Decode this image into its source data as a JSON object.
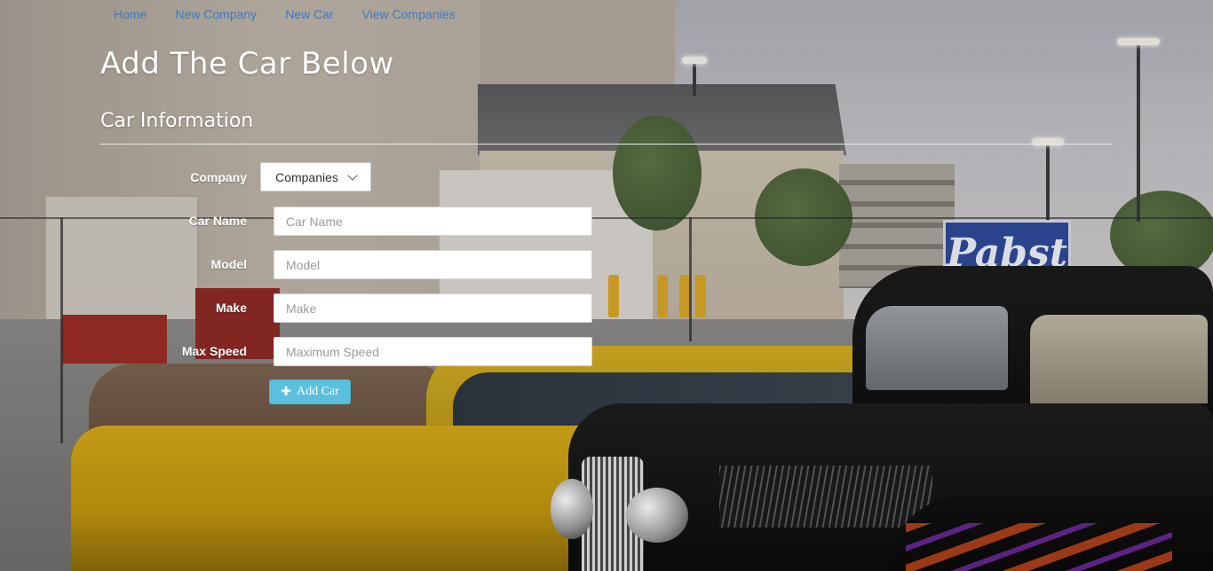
{
  "nav": {
    "items": [
      {
        "label": "Home"
      },
      {
        "label": "New Company"
      },
      {
        "label": "New Car"
      },
      {
        "label": "View Companies"
      }
    ]
  },
  "page": {
    "title": "Add The Car Below",
    "section_title": "Car Information"
  },
  "background": {
    "sign_text": "Pabst"
  },
  "form": {
    "company": {
      "label": "Company",
      "selected": "Companies"
    },
    "car_name": {
      "label": "Car Name",
      "placeholder": "Car Name",
      "value": ""
    },
    "model": {
      "label": "Model",
      "placeholder": "Model",
      "value": ""
    },
    "make": {
      "label": "Make",
      "placeholder": "Make",
      "value": ""
    },
    "max_speed": {
      "label": "Max Speed",
      "placeholder": "Maximum Speed",
      "value": ""
    },
    "submit": {
      "label": "Add Car",
      "icon": "plus-icon"
    }
  },
  "colors": {
    "link": "#3a7bc8",
    "info_button": "#5bc0de",
    "heading_text": "#ffffff"
  }
}
